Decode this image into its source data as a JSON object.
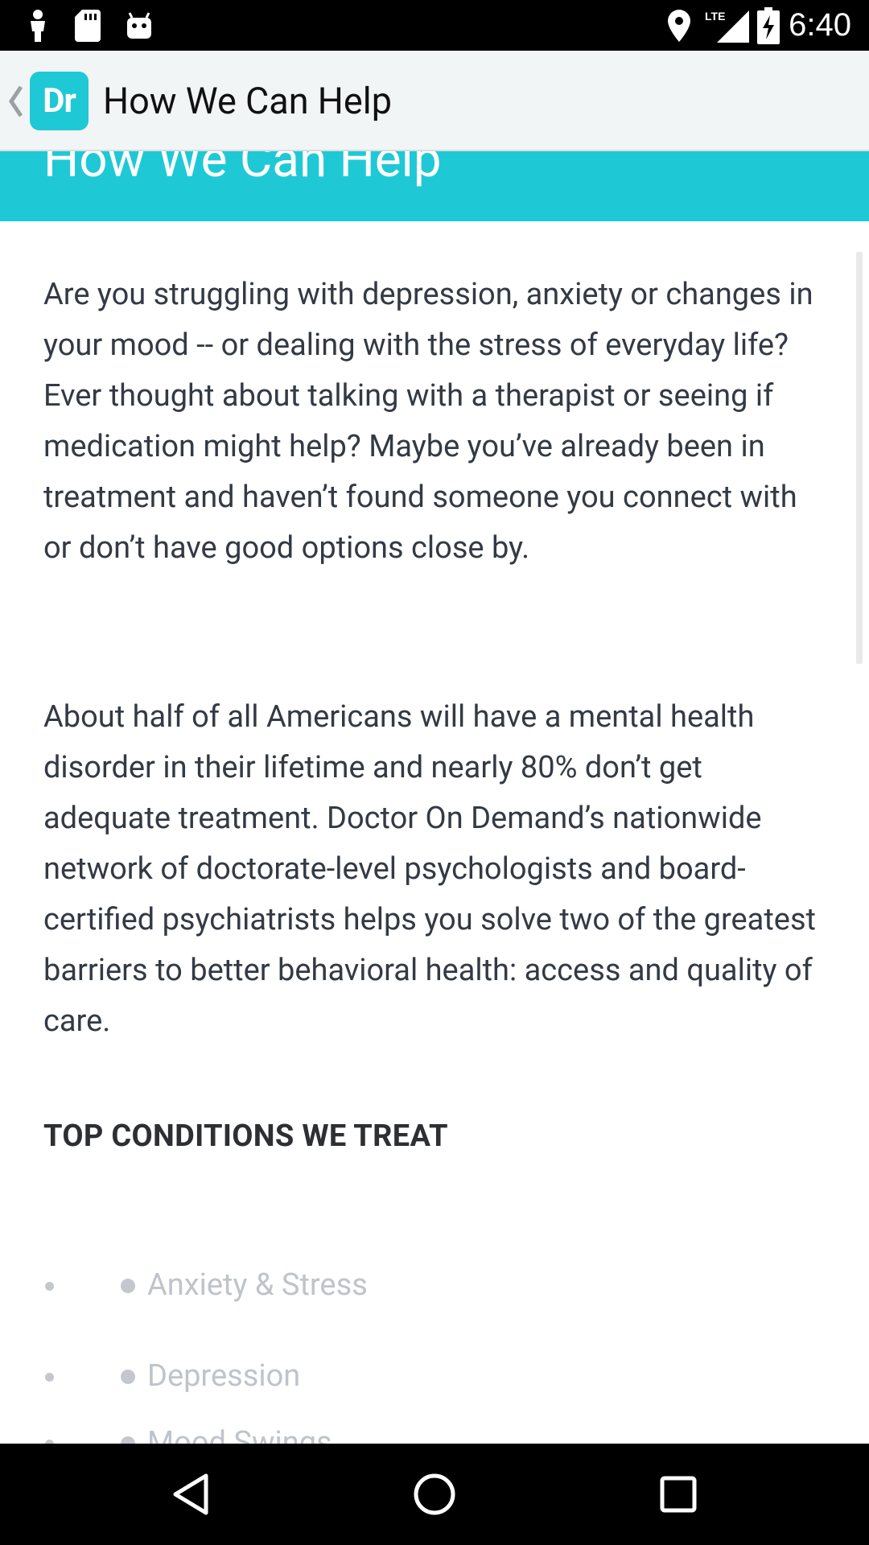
{
  "status_bar": {
    "time": "6:40",
    "network": "LTE",
    "icons": [
      "person-icon",
      "sd-card-icon",
      "android-icon",
      "location-icon",
      "lte-signal-icon",
      "battery-charging-icon"
    ]
  },
  "app_bar": {
    "logo_text": "Dr",
    "title": "How We Can Help",
    "back_icon": "chevron-left-icon"
  },
  "hero": {
    "title": "How We Can Help"
  },
  "content": {
    "paragraphs": [
      "Are you struggling with depression, anxiety or changes in your mood -- or dealing with the stress of everyday life? Ever thought about talking with a therapist or seeing if medication might help? Maybe you’ve already been in treatment and haven’t found someone you connect with or don’t have good options close by.",
      "About half of all Americans will have a mental health disorder in their lifetime and nearly 80% don’t get adequate treatment. Doctor On Demand’s nationwide network of doctorate-level psychologists and board-certified psychiatrists helps you solve two of the greatest barriers to better behavioral health: access and quality of care."
    ],
    "section_heading": "TOP CONDITIONS WE TREAT",
    "conditions": [
      "Anxiety & Stress",
      "Depression",
      "Mood Swings"
    ]
  },
  "nav_bar": {
    "icons": [
      "back-triangle-icon",
      "home-circle-icon",
      "recents-square-icon"
    ]
  },
  "colors": {
    "brand_teal": "#1ec9d5",
    "app_bar_bg": "#f2f5f6",
    "body_text": "#333a44",
    "muted_text": "#bfc4cb"
  }
}
